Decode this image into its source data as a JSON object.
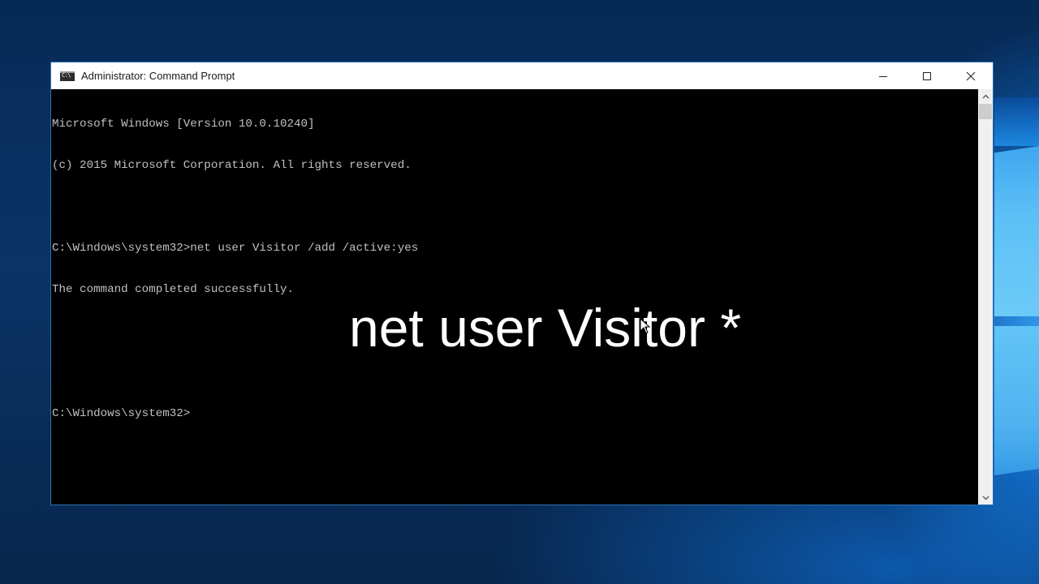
{
  "window": {
    "title": "Administrator: Command Prompt",
    "icon": "cmd-icon",
    "controls": {
      "minimize": "minimize-icon",
      "maximize": "maximize-icon",
      "close": "close-icon"
    }
  },
  "console": {
    "lines": [
      "Microsoft Windows [Version 10.0.10240]",
      "(c) 2015 Microsoft Corporation. All rights reserved.",
      "",
      "C:\\Windows\\system32>net user Visitor /add /active:yes",
      "The command completed successfully.",
      "",
      "",
      "C:\\Windows\\system32>"
    ],
    "text_color": "#c0c0c0",
    "background": "#000000"
  },
  "overlay": {
    "caption": "net user Visitor *"
  },
  "scrollbar": {
    "up_icon": "chevron-up-icon",
    "down_icon": "chevron-down-icon"
  }
}
